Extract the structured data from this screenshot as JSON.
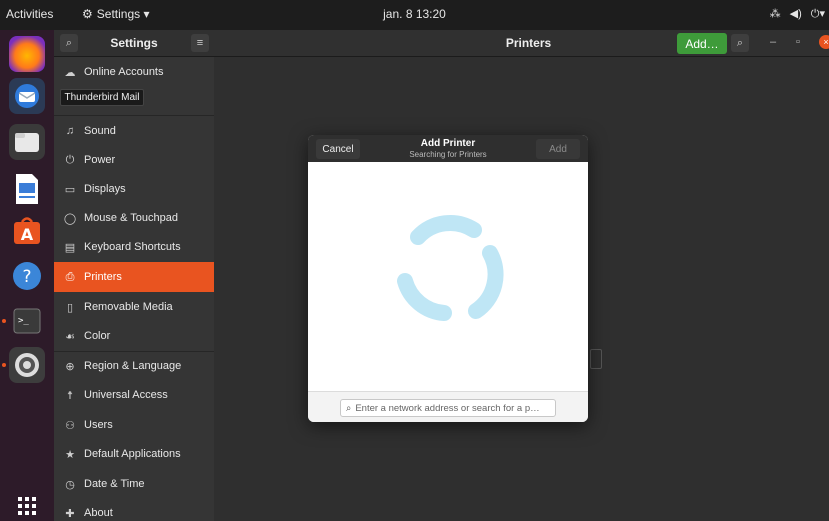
{
  "topbar": {
    "activities": "Activities",
    "app_menu": "Settings ▾",
    "clock": "jan. 8  13:20"
  },
  "tooltip": "Thunderbird Mail",
  "settings": {
    "title": "Settings",
    "page_title": "Printers",
    "add_button": "Add…"
  },
  "sidebar": {
    "items": [
      {
        "label": "Online Accounts",
        "icon": "cloud-icon"
      },
      {
        "label": "Sound",
        "icon": "music-note-icon"
      },
      {
        "label": "Power",
        "icon": "power-icon"
      },
      {
        "label": "Displays",
        "icon": "display-icon"
      },
      {
        "label": "Mouse & Touchpad",
        "icon": "mouse-icon"
      },
      {
        "label": "Keyboard Shortcuts",
        "icon": "keyboard-icon"
      },
      {
        "label": "Printers",
        "icon": "printer-icon",
        "active": true
      },
      {
        "label": "Removable Media",
        "icon": "usb-icon"
      },
      {
        "label": "Color",
        "icon": "color-icon"
      },
      {
        "label": "Region & Language",
        "icon": "globe-icon"
      },
      {
        "label": "Universal Access",
        "icon": "accessibility-icon"
      },
      {
        "label": "Users",
        "icon": "users-icon"
      },
      {
        "label": "Default Applications",
        "icon": "star-icon"
      },
      {
        "label": "Date & Time",
        "icon": "clock-icon"
      },
      {
        "label": "About",
        "icon": "plus-icon"
      }
    ]
  },
  "dialog": {
    "cancel": "Cancel",
    "title": "Add Printer",
    "subtitle": "Searching for Printers",
    "add": "Add",
    "search_placeholder": "Enter a network address or search for a p…"
  },
  "colors": {
    "accent": "#e95420",
    "add_green": "#3e9b3a",
    "spinner": "#bfe6f5"
  }
}
